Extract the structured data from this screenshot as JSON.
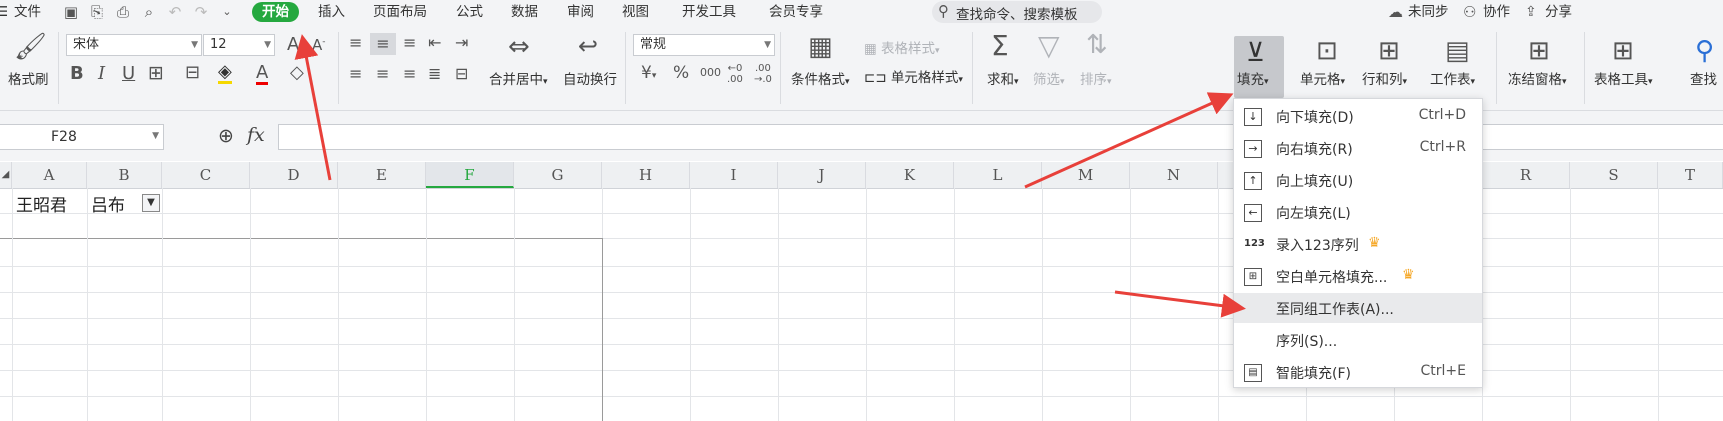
{
  "menubar": {
    "file": "文件",
    "tabs": [
      "开始",
      "插入",
      "页面布局",
      "公式",
      "数据",
      "审阅",
      "视图",
      "开发工具",
      "会员专享"
    ],
    "active_tab": "开始",
    "search_placeholder": "查找命令、搜索模板",
    "sync": "未同步",
    "collab": "协作",
    "share": "分享"
  },
  "ribbon": {
    "format_painter": "格式刷",
    "font_name": "宋体",
    "font_size": "12",
    "merge_center": "合并居中",
    "wrap_text": "自动换行",
    "number_format": "常规",
    "conditional_format": "条件格式",
    "table_style": "表格样式",
    "cell_style": "单元格样式",
    "sum": "求和",
    "filter": "筛选",
    "sort": "排序",
    "fill": "填充",
    "cell": "单元格",
    "row_col": "行和列",
    "worksheet": "工作表",
    "freeze": "冻结窗格",
    "table_tools": "表格工具",
    "find": "查找",
    "bold": "B",
    "italic": "I",
    "underline": "U",
    "font_color": "A",
    "increase_font": "A",
    "decrease_font": "A",
    "currency": "¥",
    "percent": "%",
    "thousands": "000",
    "inc_decimal_top": "←0",
    "inc_decimal_bot": ".00",
    "dec_decimal_top": ".00",
    "dec_decimal_bot": "→.0"
  },
  "formula_bar": {
    "cell_ref": "F28",
    "fx": "fx",
    "value": ""
  },
  "columns": [
    "A",
    "B",
    "C",
    "D",
    "E",
    "F",
    "G",
    "H",
    "I",
    "J",
    "K",
    "L",
    "M",
    "N",
    "O",
    "P",
    "Q",
    "R",
    "S",
    "T"
  ],
  "selected_column": "F",
  "cells": {
    "A1": "王昭君",
    "B1": "吕布"
  },
  "fill_menu": {
    "items": [
      {
        "label": "向下填充(D)",
        "shortcut": "Ctrl+D",
        "icon": "fill-down-icon"
      },
      {
        "label": "向右填充(R)",
        "shortcut": "Ctrl+R",
        "icon": "fill-right-icon"
      },
      {
        "label": "向上填充(U)",
        "shortcut": "",
        "icon": "fill-up-icon"
      },
      {
        "label": "向左填充(L)",
        "shortcut": "",
        "icon": "fill-left-icon"
      },
      {
        "label": "录入123序列",
        "shortcut": "",
        "icon": "sequence-123-icon",
        "premium": true
      },
      {
        "label": "空白单元格填充...",
        "shortcut": "",
        "icon": "blank-cell-fill-icon",
        "premium": true
      },
      {
        "label": "至同组工作表(A)...",
        "shortcut": "",
        "icon": "",
        "highlighted": true
      },
      {
        "label": "序列(S)...",
        "shortcut": "",
        "icon": ""
      },
      {
        "label": "智能填充(F)",
        "shortcut": "Ctrl+E",
        "icon": "smart-fill-icon"
      }
    ]
  },
  "colors": {
    "accent_green": "#25a83f",
    "arrow_red": "#e8403a",
    "premium_gold": "#f5a623"
  }
}
